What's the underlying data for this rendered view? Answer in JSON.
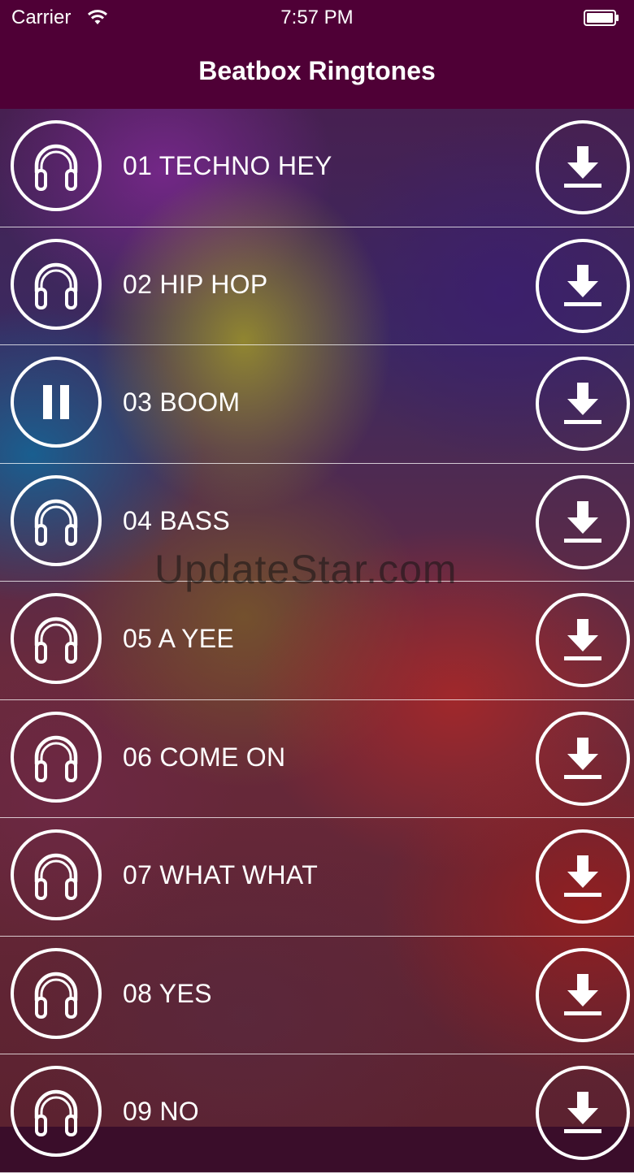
{
  "status_bar": {
    "carrier": "Carrier",
    "time": "7:57 PM"
  },
  "nav": {
    "title": "Beatbox Ringtones"
  },
  "ringtones": [
    {
      "title": "01 TECHNO HEY",
      "state": "idle"
    },
    {
      "title": "02 HIP HOP",
      "state": "idle"
    },
    {
      "title": "03 BOOM",
      "state": "playing"
    },
    {
      "title": "04 BASS",
      "state": "idle"
    },
    {
      "title": "05 A YEE",
      "state": "idle"
    },
    {
      "title": "06 COME ON",
      "state": "idle"
    },
    {
      "title": "07 WHAT WHAT",
      "state": "idle"
    },
    {
      "title": "08 YES",
      "state": "idle"
    },
    {
      "title": "09 NO",
      "state": "idle"
    }
  ],
  "icons": {
    "idle": "headphones-icon",
    "playing": "pause-icon",
    "download": "download-icon"
  },
  "watermark": "UpdateStar.com",
  "colors": {
    "bar": "#4f0036",
    "foreground": "#ffffff"
  }
}
